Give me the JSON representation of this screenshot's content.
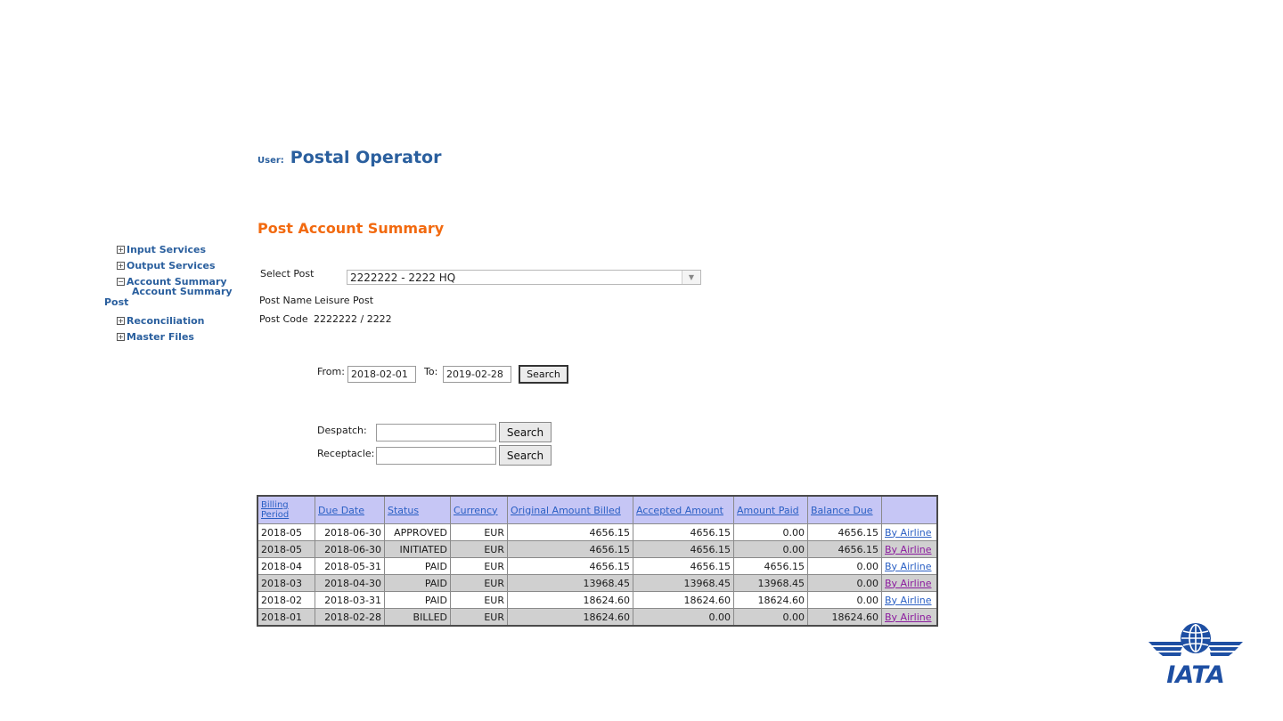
{
  "header": {
    "user_label": "User:",
    "user_name": "Postal Operator",
    "page_title": "Post Account Summary"
  },
  "sidebar": {
    "items": [
      {
        "icon": "plus-box-icon",
        "label": "Input Services"
      },
      {
        "icon": "plus-box-icon",
        "label": "Output Services"
      },
      {
        "icon": "minus-box-icon",
        "label": "Account Summary"
      },
      {
        "icon": "plus-box-icon",
        "label": "Reconciliation"
      },
      {
        "icon": "plus-box-icon",
        "label": "Master Files"
      }
    ],
    "sub_item_label": "Account Summary",
    "sub_item_tail": "Post"
  },
  "form": {
    "select_post_label": "Select Post",
    "select_post_value": "2222222 - 2222 HQ",
    "post_name_label": "Post Name",
    "post_name_value": "Leisure Post",
    "post_code_label": "Post Code",
    "post_code_value": "2222222 / 2222",
    "from_label": "From:",
    "from_value": "2018-02-01",
    "to_label": "To:",
    "to_value": "2019-02-28",
    "date_search_label": "Search",
    "despatch_label": "Despatch:",
    "despatch_value": "",
    "despatch_search_label": "Search",
    "receptacle_label": "Receptacle:",
    "receptacle_value": "",
    "receptacle_search_label": "Search"
  },
  "table": {
    "headers": {
      "billing_period_1": "Billing",
      "billing_period_2": "Period",
      "due_date": "Due Date",
      "status": "Status",
      "currency": "Currency",
      "original_amount_billed": "Original Amount Billed",
      "accepted_amount": "Accepted Amount",
      "amount_paid": "Amount Paid",
      "balance_due": "Balance Due"
    },
    "rows": [
      {
        "period": "2018-05",
        "due": "2018-06-30",
        "status": "APPROVED",
        "currency": "EUR",
        "original": "4656.15",
        "accepted": "4656.15",
        "paid": "0.00",
        "balance": "4656.15",
        "link": "By Airline"
      },
      {
        "period": "2018-05",
        "due": "2018-06-30",
        "status": "INITIATED",
        "currency": "EUR",
        "original": "4656.15",
        "accepted": "4656.15",
        "paid": "0.00",
        "balance": "4656.15",
        "link": "By Airline"
      },
      {
        "period": "2018-04",
        "due": "2018-05-31",
        "status": "PAID",
        "currency": "EUR",
        "original": "4656.15",
        "accepted": "4656.15",
        "paid": "4656.15",
        "balance": "0.00",
        "link": "By Airline"
      },
      {
        "period": "2018-03",
        "due": "2018-04-30",
        "status": "PAID",
        "currency": "EUR",
        "original": "13968.45",
        "accepted": "13968.45",
        "paid": "13968.45",
        "balance": "0.00",
        "link": "By Airline"
      },
      {
        "period": "2018-02",
        "due": "2018-03-31",
        "status": "PAID",
        "currency": "EUR",
        "original": "18624.60",
        "accepted": "18624.60",
        "paid": "18624.60",
        "balance": "0.00",
        "link": "By Airline"
      },
      {
        "period": "2018-01",
        "due": "2018-02-28",
        "status": "BILLED",
        "currency": "EUR",
        "original": "18624.60",
        "accepted": "0.00",
        "paid": "0.00",
        "balance": "18624.60",
        "link": "By Airline"
      }
    ]
  },
  "logo": {
    "text": "IATA",
    "icon": "iata-globe-wings-logo"
  },
  "colors": {
    "brand_blue": "#2a5f9e",
    "title_orange": "#f26a10",
    "table_header_bg": "#c6c6f5",
    "alt_row_bg": "#d0d0d0",
    "link_blue": "#2a5fc4",
    "link_purple": "#8b1a9e",
    "logo_blue": "#1e4fa3"
  }
}
